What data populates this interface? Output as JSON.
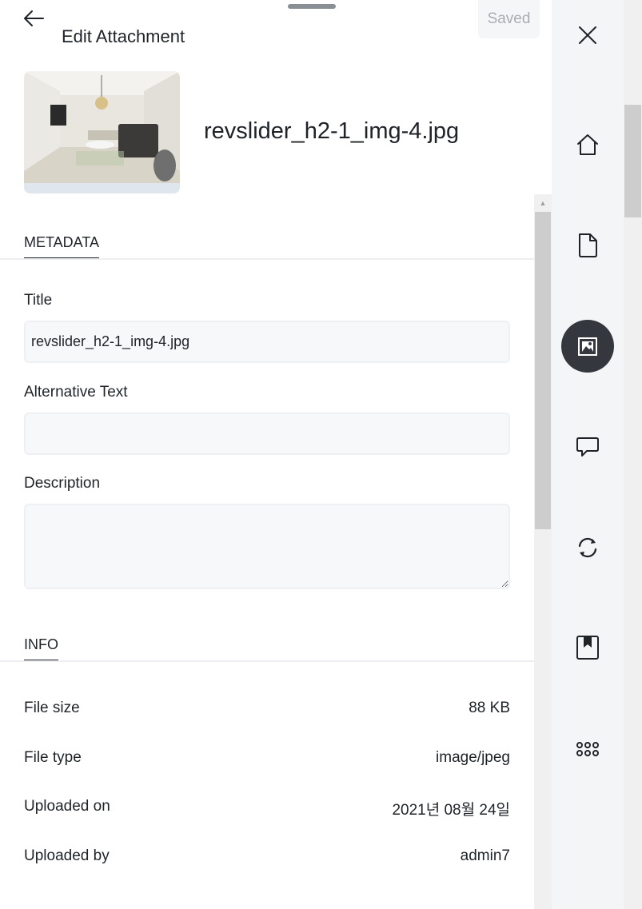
{
  "header": {
    "title": "Edit Attachment",
    "saved_label": "Saved"
  },
  "attachment": {
    "file_name": "revslider_h2-1_img-4.jpg"
  },
  "tabs": {
    "metadata": "METADATA",
    "info": "INFO"
  },
  "form": {
    "title_label": "Title",
    "title_value": "revslider_h2-1_img-4.jpg",
    "alt_label": "Alternative Text",
    "alt_value": "",
    "description_label": "Description",
    "description_value": ""
  },
  "info": {
    "rows": [
      {
        "label": "File size",
        "value": "88 KB"
      },
      {
        "label": "File type",
        "value": "image/jpeg"
      },
      {
        "label": "Uploaded on",
        "value": "2021년 08월 24일"
      },
      {
        "label": "Uploaded by",
        "value": "admin7"
      }
    ]
  },
  "rail": {
    "items": [
      {
        "icon": "close-icon"
      },
      {
        "icon": "home-icon"
      },
      {
        "icon": "page-icon"
      },
      {
        "icon": "media-icon",
        "active": true
      },
      {
        "icon": "comment-icon"
      },
      {
        "icon": "sync-icon"
      },
      {
        "icon": "bookmark-icon"
      },
      {
        "icon": "apps-grid-icon"
      }
    ]
  },
  "colors": {
    "active_rail": "#34383e",
    "field_bg": "#f7f8fa",
    "rail_bg": "#f4f5f7"
  }
}
